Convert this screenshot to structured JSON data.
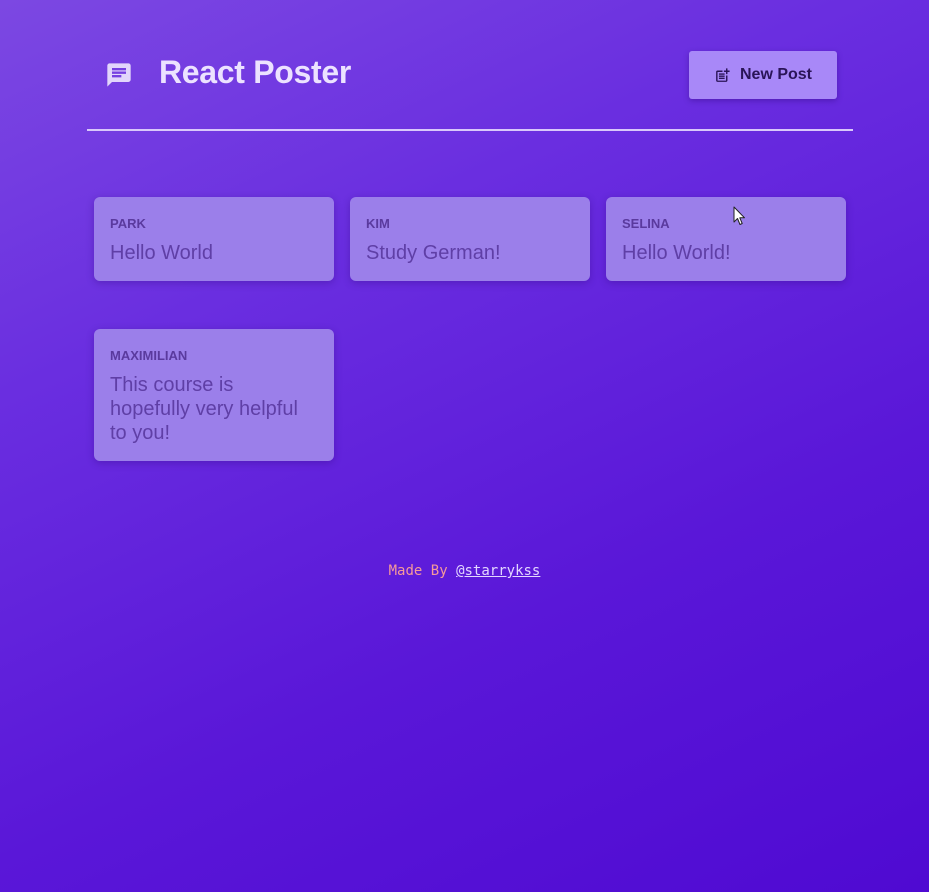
{
  "header": {
    "title": "React Poster",
    "logo_icon": "message-icon",
    "new_post_label": "New Post",
    "new_post_icon": "post-add-icon"
  },
  "posts": [
    {
      "author": "PARK",
      "body": "Hello World"
    },
    {
      "author": "KIM",
      "body": "Study German!"
    },
    {
      "author": "SELINA",
      "body": "Hello World!"
    },
    {
      "author": "MAXIMILIAN",
      "body": "This course is hopefully very helpful to you!"
    }
  ],
  "footer": {
    "made_by": "Made By",
    "handle": "@starrykss"
  },
  "colors": {
    "background_top": "#7c48e2",
    "background_bottom": "#4f0ad2",
    "card": "#9b7fea",
    "button": "#a888f8",
    "title_text": "#ece2ff",
    "made_by_text": "#f59a9a"
  }
}
